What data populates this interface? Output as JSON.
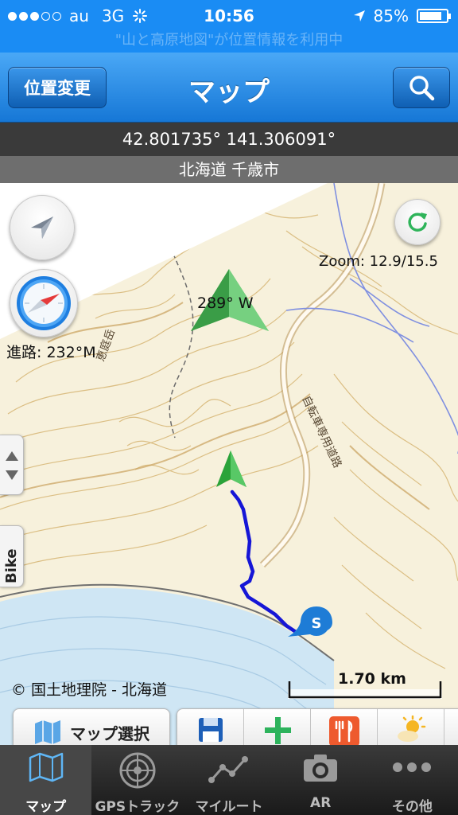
{
  "status_bar": {
    "carrier": "au",
    "network": "3G",
    "time": "10:56",
    "battery": "85%",
    "battery_level": 0.85,
    "signal_bars": 3,
    "signal_total": 5
  },
  "location_banner": "\"山と高原地図\"が位置情報を利用中",
  "nav": {
    "location_button": "位置変更",
    "title": "マップ",
    "search_icon": "search-icon"
  },
  "coordinates": "42.801735° 141.306091°",
  "place": "北海道 千歳市",
  "map": {
    "zoom": "Zoom: 12.9/15.5",
    "heading": "289° W",
    "course": "進路: 232°M",
    "copyright": "© 国土地理院 - 北海道",
    "scale": "1.70 km",
    "side_tab": "Bike",
    "start_marker": "S",
    "route_color": "#1616d6"
  },
  "toolbar": {
    "map_select": "マップ選択",
    "tools": [
      "save-icon",
      "add-icon",
      "restaurant-icon",
      "weather-icon"
    ]
  },
  "tabs": [
    {
      "label": "マップ",
      "icon": "map-icon",
      "active": true
    },
    {
      "label": "GPSトラック",
      "icon": "radar-icon",
      "active": false
    },
    {
      "label": "マイルート",
      "icon": "route-icon",
      "active": false
    },
    {
      "label": "AR",
      "icon": "camera-icon",
      "active": false
    },
    {
      "label": "その他",
      "icon": "more-icon",
      "active": false
    }
  ]
}
